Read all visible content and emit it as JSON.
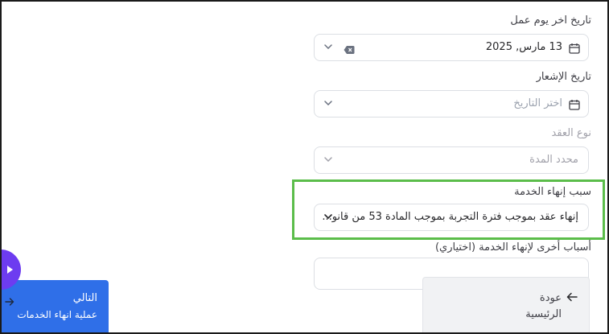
{
  "form": {
    "last_work_day": {
      "label": "تاريخ اخر يوم عمل",
      "value": "13 مارس, 2025"
    },
    "notice_date": {
      "label": "تاريخ الإشعار",
      "placeholder": "اختر التاريخ"
    },
    "contract_type": {
      "label": "نوع العقد",
      "value": "محدد المدة"
    },
    "termination_reason": {
      "label": "سبب إنهاء الخدمة",
      "value": "إنهاء عقد بموجب فترة التجربة بموجب المادة 53 من قانو..."
    },
    "other_reasons": {
      "label": "أسباب أخرى لإنهاء الخدمة (اختياري)"
    }
  },
  "buttons": {
    "home_line1": "عودة",
    "home_line2": "الرئيسية",
    "next_title": "التالي",
    "next_subtitle": "عملية انهاء الخدمات"
  },
  "icons": {
    "calendar": "calendar-icon",
    "chevron": "chevron-down-icon",
    "clear": "clear-icon",
    "arrow_right": "arrow-right-icon",
    "arrow_left": "arrow-left-icon",
    "play": "play-icon"
  },
  "colors": {
    "highlight": "#5bbd4a",
    "primary": "#2f6fe8",
    "fab": "#6d3cf0"
  }
}
